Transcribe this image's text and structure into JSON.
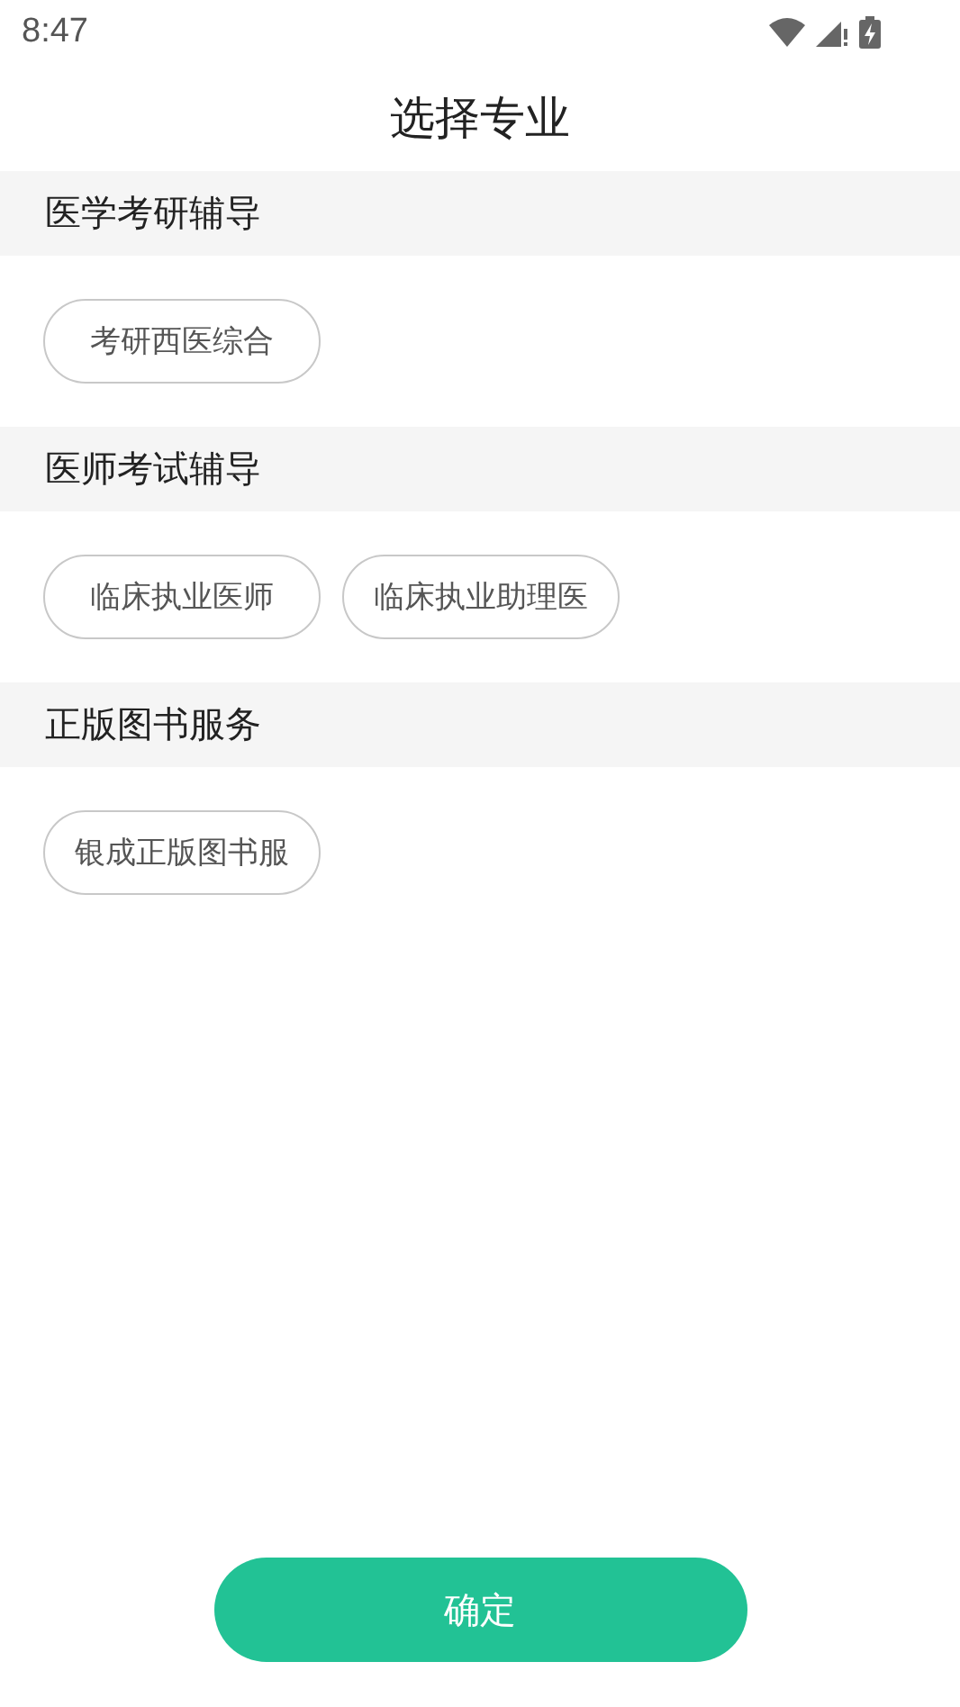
{
  "status_bar": {
    "time": "8:47"
  },
  "title": "选择专业",
  "sections": [
    {
      "title": "医学考研辅导",
      "options": [
        {
          "label": "考研西医综合",
          "selected": false
        }
      ]
    },
    {
      "title": "医师考试辅导",
      "options": [
        {
          "label": "临床执业医师",
          "selected": false
        },
        {
          "label": "临床执业助理医",
          "selected": false
        }
      ]
    },
    {
      "title": "正版图书服务",
      "options": [
        {
          "label": "银成正版图书服",
          "selected": false
        }
      ]
    }
  ],
  "confirm_button": "确定"
}
